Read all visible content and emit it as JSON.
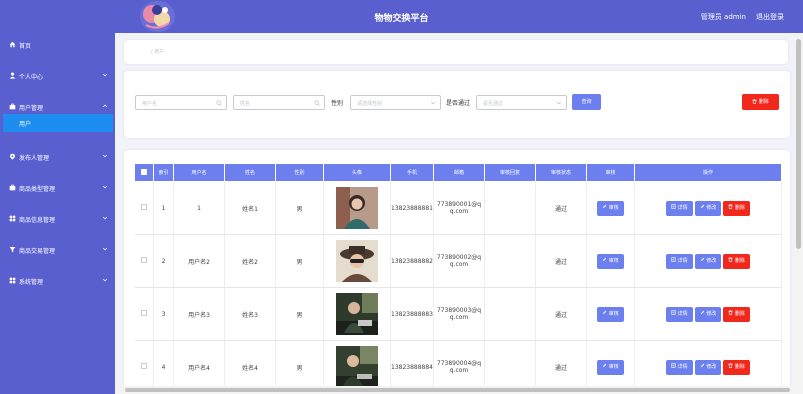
{
  "header": {
    "app_title": "物物交换平台",
    "admin_label": "管理员 admin",
    "logout_label": "退出登录"
  },
  "sidebar": {
    "items": [
      {
        "label": "首页",
        "icon": "home-icon",
        "chevron": false
      },
      {
        "label": "个人中心",
        "icon": "person-icon",
        "chevron": true
      },
      {
        "label": "用户管理",
        "icon": "briefcase-icon",
        "chevron": true
      },
      {
        "label": "发布人管理",
        "icon": "location-icon",
        "chevron": true
      },
      {
        "label": "商品类型管理",
        "icon": "briefcase-icon",
        "chevron": true
      },
      {
        "label": "商品信息管理",
        "icon": "grid-icon",
        "chevron": true
      },
      {
        "label": "商品交易管理",
        "icon": "funnel-icon",
        "chevron": true
      },
      {
        "label": "系统管理",
        "icon": "grid-icon",
        "chevron": true
      }
    ],
    "active_sub": "用户"
  },
  "breadcrumb": "/ 用户",
  "filters": {
    "username_placeholder": "用户名",
    "name_placeholder": "姓名",
    "gender_label": "性别",
    "gender_placeholder": "请选择性别",
    "approved_label": "是否通过",
    "approved_placeholder": "是否通过",
    "search_button": "查询",
    "delete_button": "删除"
  },
  "table": {
    "columns": [
      "索引",
      "用户名",
      "姓名",
      "性别",
      "头像",
      "手机",
      "邮箱",
      "审核回复",
      "审核状态",
      "审核",
      "操作"
    ],
    "rows": [
      {
        "index": "1",
        "username": "1",
        "name": "姓名1",
        "gender": "男",
        "phone": "13823888881",
        "email_1": "773890001@q",
        "email_2": "q.com",
        "reply": "",
        "status": "通过"
      },
      {
        "index": "2",
        "username": "用户名2",
        "name": "姓名2",
        "gender": "男",
        "phone": "13823888882",
        "email_1": "773890002@q",
        "email_2": "q.com",
        "reply": "",
        "status": "通过"
      },
      {
        "index": "3",
        "username": "用户名3",
        "name": "姓名3",
        "gender": "男",
        "phone": "13823888883",
        "email_1": "773890003@q",
        "email_2": "q.com",
        "reply": "",
        "status": "通过"
      },
      {
        "index": "4",
        "username": "用户名4",
        "name": "姓名4",
        "gender": "男",
        "phone": "13823888884",
        "email_1": "773890004@q",
        "email_2": "q.com",
        "reply": "",
        "status": "通过"
      }
    ],
    "actions": {
      "audit": "审核",
      "detail": "详情",
      "edit": "修改",
      "delete": "删除"
    }
  },
  "colors": {
    "primary": "#5a5fcf",
    "header_row": "#6d7fee",
    "button_blue": "#6b7fef",
    "button_red": "#f2281d",
    "active_sub": "#1d8ef0"
  }
}
